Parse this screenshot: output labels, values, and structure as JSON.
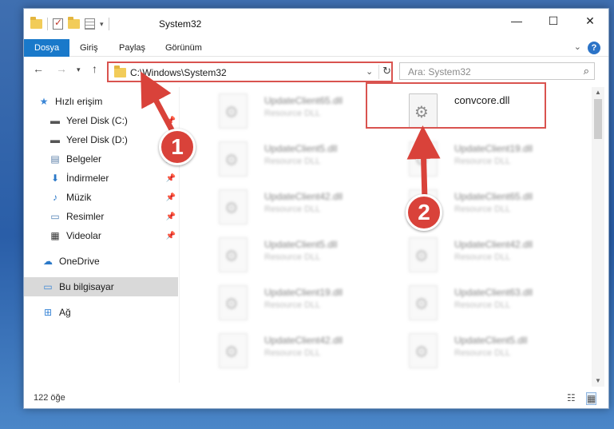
{
  "window": {
    "title": "System32"
  },
  "ribbon": {
    "tabs": [
      {
        "label": "Dosya",
        "active": true
      },
      {
        "label": "Giriş",
        "active": false
      },
      {
        "label": "Paylaş",
        "active": false
      },
      {
        "label": "Görünüm",
        "active": false
      }
    ],
    "help_label": "?"
  },
  "address": {
    "path": "C:\\Windows\\System32"
  },
  "search": {
    "placeholder": "Ara: System32"
  },
  "sidebar": {
    "items": [
      {
        "label": "Hızlı erişim",
        "icon": "star-icon"
      },
      {
        "label": "Yerel Disk (C:)",
        "icon": "drive-icon"
      },
      {
        "label": "Yerel Disk (D:)",
        "icon": "drive-icon"
      },
      {
        "label": "Belgeler",
        "icon": "documents-icon"
      },
      {
        "label": "İndirmeler",
        "icon": "download-icon"
      },
      {
        "label": "Müzik",
        "icon": "music-icon"
      },
      {
        "label": "Resimler",
        "icon": "pictures-icon"
      },
      {
        "label": "Videolar",
        "icon": "video-icon"
      },
      {
        "label": "OneDrive",
        "icon": "cloud-icon"
      },
      {
        "label": "Bu bilgisayar",
        "icon": "computer-icon"
      },
      {
        "label": "Ağ",
        "icon": "network-icon"
      }
    ]
  },
  "files": {
    "left": [
      {
        "name": "UpdateClient65.dll",
        "type": "Resource DLL"
      },
      {
        "name": "UpdateClient5.dll",
        "type": "Resource DLL"
      },
      {
        "name": "UpdateClient42.dll",
        "type": "Resource DLL"
      },
      {
        "name": "UpdateClient5.dll",
        "type": "Resource DLL"
      },
      {
        "name": "UpdateClient19.dll",
        "type": "Resource DLL"
      },
      {
        "name": "UpdateClient42.dll",
        "type": "Resource DLL"
      }
    ],
    "right": [
      {
        "name": "convcore.dll",
        "type": ""
      },
      {
        "name": "UpdateClient19.dll",
        "type": "Resource DLL"
      },
      {
        "name": "UpdateClient65.dll",
        "type": "Resource DLL"
      },
      {
        "name": "UpdateClient42.dll",
        "type": "Resource DLL"
      },
      {
        "name": "UpdateClient63.dll",
        "type": "Resource DLL"
      },
      {
        "name": "UpdateClient5.dll",
        "type": "Resource DLL"
      }
    ]
  },
  "status": {
    "count": "122 öğe"
  },
  "callouts": {
    "one": "1",
    "two": "2"
  },
  "colors": {
    "accent": "#1979ca",
    "highlight": "#d9534f",
    "callout": "#d9423a"
  }
}
